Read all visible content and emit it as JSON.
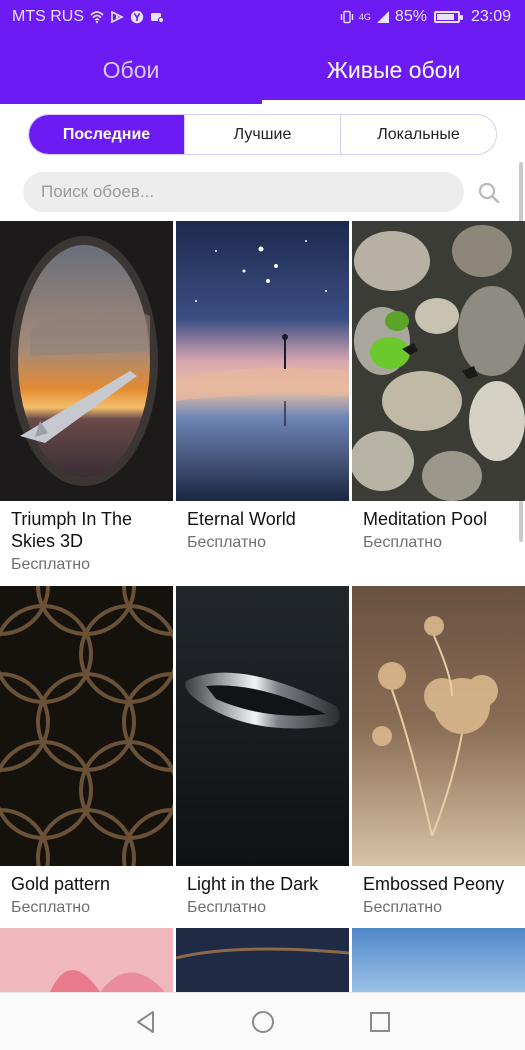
{
  "status_bar": {
    "carrier": "MTS RUS",
    "network": "4G",
    "battery_level": "85%",
    "time": "23:09",
    "icons": [
      "wifi-icon",
      "media-icon",
      "yandex-icon",
      "media-alt-icon",
      "vibrate-icon",
      "signal-icon",
      "battery-icon"
    ]
  },
  "tabs": [
    {
      "label": "Обои",
      "active": false
    },
    {
      "label": "Живые обои",
      "active": true
    }
  ],
  "segments": [
    "Последние",
    "Лучшие",
    "Локальные"
  ],
  "search": {
    "placeholder": "Поиск обоев..."
  },
  "wallpapers": [
    {
      "title": "Triumph In The Skies 3D",
      "price": "Бесплатно",
      "image": "airplane-window-sunset"
    },
    {
      "title": "Eternal World",
      "price": "Бесплатно",
      "image": "starry-sky-reflection"
    },
    {
      "title": "Meditation Pool",
      "price": "Бесплатно",
      "image": "pebbles-goldfish"
    },
    {
      "title": "Gold pattern",
      "price": "Бесплатно",
      "image": "gold-circle-pattern"
    },
    {
      "title": " Light in the Dark",
      "price": "Бесплатно",
      "image": "dark-metal-ring"
    },
    {
      "title": "Embossed Peony",
      "price": "Бесплатно",
      "image": "golden-peony"
    },
    {
      "title": "",
      "price": "",
      "image": "pink-lotus"
    },
    {
      "title": "",
      "price": "",
      "image": "dark-ocean"
    },
    {
      "title": "",
      "price": "",
      "image": "blue-sky"
    }
  ],
  "colors": {
    "accent": "#6c1cf2",
    "price_text": "#6f6f6f"
  },
  "nav": [
    "back-icon",
    "home-icon",
    "recents-icon"
  ]
}
